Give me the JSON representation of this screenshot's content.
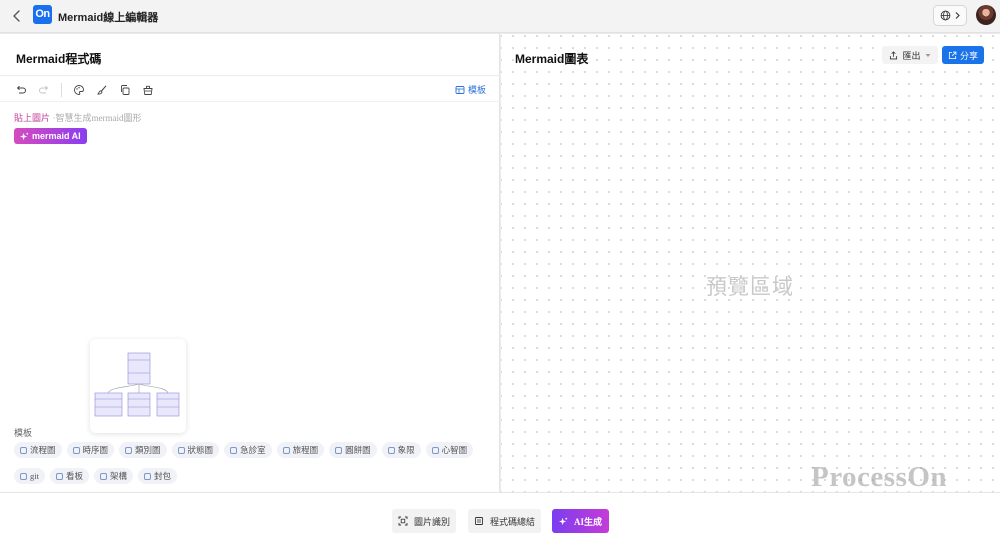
{
  "app": {
    "logo_text": "On",
    "title": "Mermaid線上編輯器"
  },
  "left_panel": {
    "title": "Mermaid程式碼",
    "toolbar": {
      "icons": [
        "undo-icon",
        "redo-icon",
        "palette-icon",
        "brush-icon",
        "copy-icon",
        "clear-icon"
      ],
      "template_label": "模板"
    },
    "paste_hint": {
      "link": "貼上圖片",
      "text": "·智慧生成mermaid圖形"
    },
    "ai_badge": "mermaid AI",
    "template_section_label": "模板",
    "chips_row1": [
      {
        "label": "流程圖",
        "icon": "flowchart-icon"
      },
      {
        "label": "時序圖",
        "icon": "sequence-icon"
      },
      {
        "label": "類別圖",
        "icon": "class-icon"
      },
      {
        "label": "狀態圖",
        "icon": "state-icon"
      },
      {
        "label": "急診室",
        "icon": "er-icon"
      },
      {
        "label": "旅程圖",
        "icon": "journey-icon"
      },
      {
        "label": "圓餅圖",
        "icon": "pie-icon"
      },
      {
        "label": "象限",
        "icon": "quadrant-icon"
      },
      {
        "label": "心智圖",
        "icon": "mindmap-icon"
      }
    ],
    "chips_row2": [
      {
        "label": "git",
        "icon": "git-icon"
      },
      {
        "label": "看板",
        "icon": "kanban-icon"
      },
      {
        "label": "架構",
        "icon": "architecture-icon"
      },
      {
        "label": "封包",
        "icon": "packet-icon"
      }
    ]
  },
  "right_panel": {
    "title": "Mermaid圖表",
    "export_label": "匯出",
    "share_label": "分享",
    "preview_placeholder": "預覽區域",
    "watermark": "ProcessOn"
  },
  "bottom_bar": {
    "image_recognize": "圖片識別",
    "code_summary": "程式碼總結",
    "ai_generate": "AI生成"
  },
  "colors": {
    "accent_blue": "#1a73e8",
    "logo_blue": "#1a6ff0",
    "ai_gradient_start": "#7b3df0",
    "ai_gradient_end": "#c43cd7",
    "paste_link": "#c2409a"
  }
}
